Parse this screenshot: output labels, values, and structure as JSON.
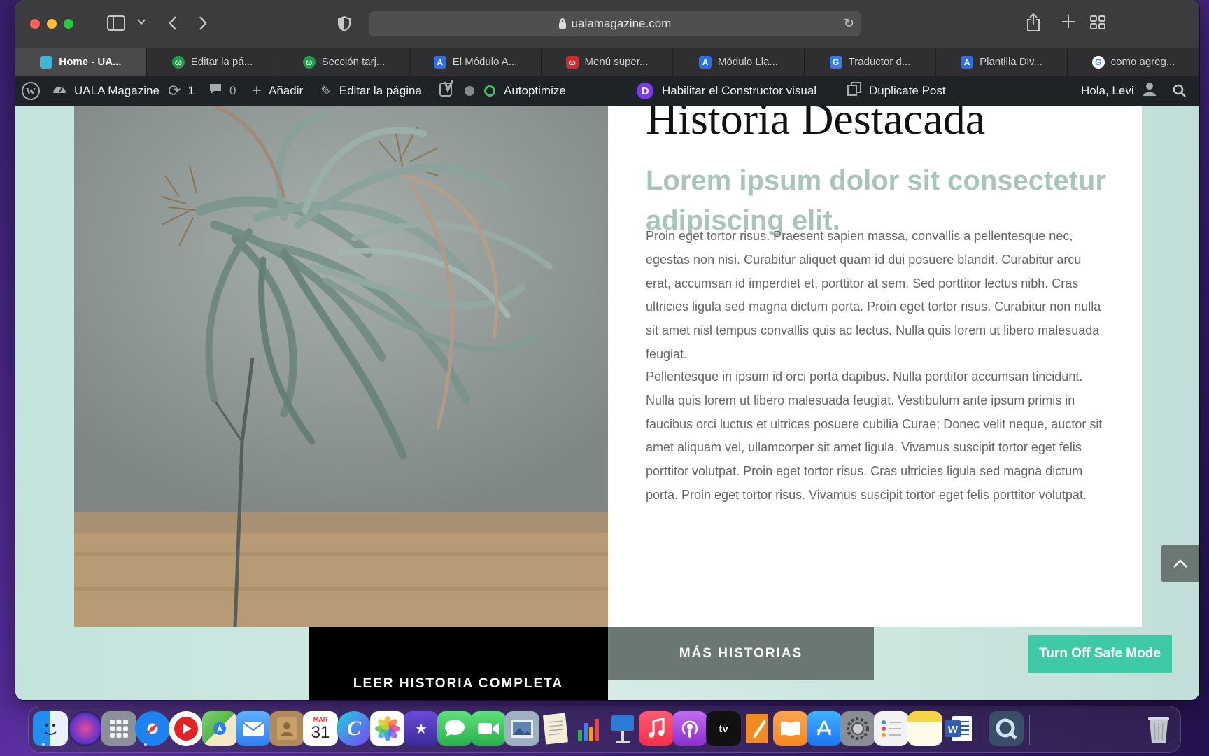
{
  "browser": {
    "url": "ualamagazine.com",
    "tabs": [
      {
        "label": "Home - UA...",
        "active": true,
        "favicon_color": "#3fb6d6",
        "favicon_glyph": ""
      },
      {
        "label": "Editar la pá...",
        "active": false,
        "favicon_color": "#1e9e4a",
        "favicon_glyph": "ω"
      },
      {
        "label": "Sección tarj...",
        "active": false,
        "favicon_color": "#1e9e4a",
        "favicon_glyph": "ω"
      },
      {
        "label": "El Módulo A...",
        "active": false,
        "favicon_color": "#2f6fe0",
        "favicon_glyph": "A"
      },
      {
        "label": "Menú super...",
        "active": false,
        "favicon_color": "#d02a2a",
        "favicon_glyph": "ω"
      },
      {
        "label": "Módulo Lla...",
        "active": false,
        "favicon_color": "#2f6fe0",
        "favicon_glyph": "A"
      },
      {
        "label": "Traductor d...",
        "active": false,
        "favicon_color": "#3b7be8",
        "favicon_glyph": "G"
      },
      {
        "label": "Plantilla Div...",
        "active": false,
        "favicon_color": "#2f6fe0",
        "favicon_glyph": "A"
      },
      {
        "label": "como agreg...",
        "active": false,
        "favicon_color": "#ffffff",
        "favicon_glyph": "G"
      }
    ]
  },
  "adminbar": {
    "site_name": "UALA Magazine",
    "updates_count": "1",
    "comments_count": "0",
    "add_label": "Añadir",
    "edit_label": "Editar la página",
    "autoptimize_label": "Autoptimize",
    "builder_label": "Habilitar el Constructor visual",
    "duplicate_label": "Duplicate Post",
    "greeting": "Hola, Levi"
  },
  "feature": {
    "heading": "Historia Destacada",
    "subheading": "Lorem ipsum dolor sit consectetur adipiscing elit.",
    "paragraph_1": "Proin eget tortor risus. Praesent sapien massa, convallis a pellentesque nec, egestas non nisi. Curabitur aliquet quam id dui posuere blandit. Curabitur arcu erat, accumsan id imperdiet et, porttitor at sem. Sed porttitor lectus nibh. Cras ultricies ligula sed magna dictum porta. Proin eget tortor risus. Curabitur non nulla sit amet nisl tempus convallis quis ac lectus. Nulla quis lorem ut libero malesuada feugiat.",
    "paragraph_2": "Pellentesque in ipsum id orci porta dapibus. Nulla porttitor accumsan tincidunt. Nulla quis lorem ut libero malesuada feugiat. Vestibulum ante ipsum primis in faucibus orci luctus et ultrices posuere cubilia Curae; Donec velit neque, auctor sit amet aliquam vel, ullamcorper sit amet ligula. Vivamus suscipit tortor eget felis porttitor volutpat. Proin eget tortor risus. Cras ultricies ligula sed magna dictum porta. Proin eget tortor risus. Vivamus suscipit tortor eget felis porttitor volutpat.",
    "read_button": "LEER HISTORIA COMPLETA",
    "more_button": "MÁS HISTORIAS",
    "safe_mode_button": "Turn Off Safe Mode"
  },
  "dock": {
    "calendar_month": "MAR",
    "calendar_day": "31",
    "tv_label": "tv",
    "apps": [
      {
        "name": "finder-icon",
        "color": "#1e8ef0"
      },
      {
        "name": "siri-icon",
        "color": "#7a3fd0"
      },
      {
        "name": "launchpad-icon",
        "color": "#9aa0a8"
      },
      {
        "name": "safari-icon",
        "color": "#1b84f0"
      },
      {
        "name": "youtube-icon",
        "color": "#e52222"
      },
      {
        "name": "maps-icon",
        "color": "#56b84c"
      },
      {
        "name": "mail-icon",
        "color": "#2f8ef2"
      },
      {
        "name": "contacts-icon",
        "color": "#b08a5a"
      },
      {
        "name": "calendar-icon",
        "color": "#ffffff"
      },
      {
        "name": "canva-icon",
        "color": "#1fb6d8"
      },
      {
        "name": "photos-icon",
        "color": "#f2b632"
      },
      {
        "name": "imovie-icon",
        "color": "#6a4bd8"
      },
      {
        "name": "messages-icon",
        "color": "#35c759"
      },
      {
        "name": "facetime-icon",
        "color": "#2fbf4f"
      },
      {
        "name": "preview-icon",
        "color": "#8fa3b8"
      },
      {
        "name": "textedit-icon",
        "color": "#e9e3d2"
      },
      {
        "name": "numbers-icon",
        "color": "#2fae4a"
      },
      {
        "name": "keynote-icon",
        "color": "#2c7bd6"
      },
      {
        "name": "music-icon",
        "color": "#fa2d48"
      },
      {
        "name": "podcasts-icon",
        "color": "#a64bde"
      },
      {
        "name": "appletv-icon",
        "color": "#111111"
      },
      {
        "name": "pages-icon",
        "color": "#f58b1f"
      },
      {
        "name": "books-icon",
        "color": "#f6861f"
      },
      {
        "name": "appstore-icon",
        "color": "#1c8ef3"
      },
      {
        "name": "system-preferences-icon",
        "color": "#8a8e94"
      },
      {
        "name": "reminders-icon",
        "color": "#f2f2f2"
      },
      {
        "name": "notes-icon",
        "color": "#f7d44a"
      },
      {
        "name": "word-icon",
        "color": "#2a5fb8"
      },
      {
        "name": "quicktime-icon",
        "color": "#3a4e6a"
      },
      {
        "name": "trash-icon",
        "color": "#cfd3d8"
      }
    ]
  }
}
